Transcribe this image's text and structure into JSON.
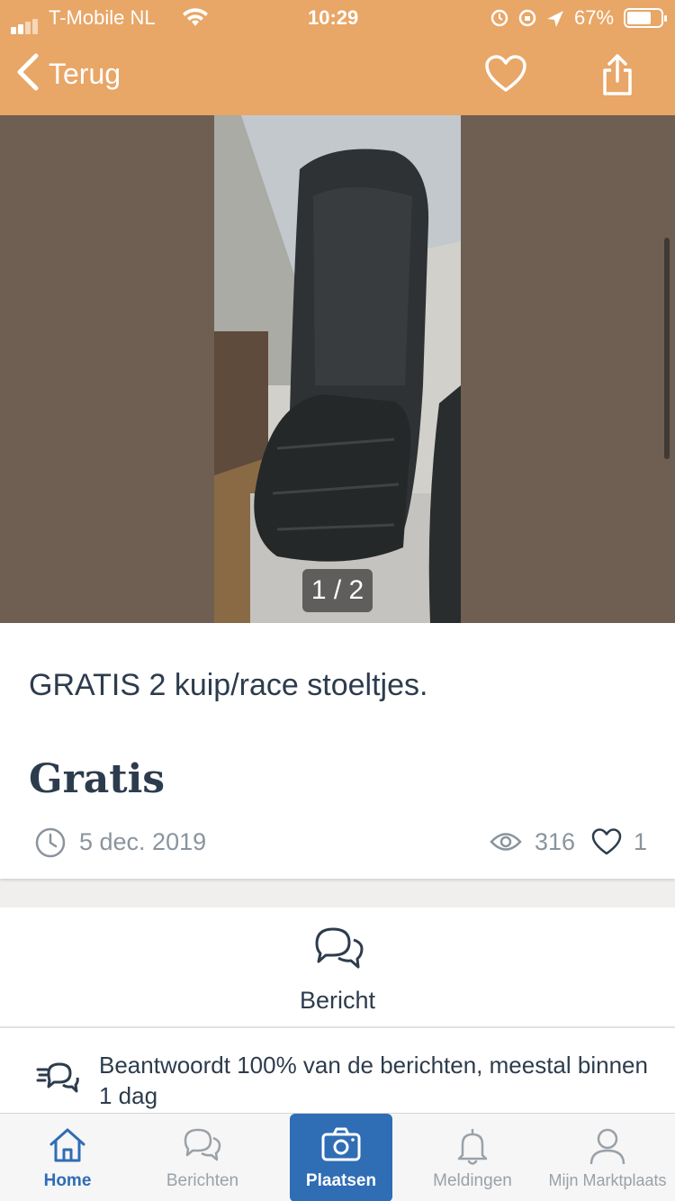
{
  "status_bar": {
    "carrier": "T-Mobile NL",
    "time": "10:29",
    "battery": "67%"
  },
  "nav": {
    "back_label": "Terug"
  },
  "gallery": {
    "counter": "1 / 2"
  },
  "listing": {
    "title": "GRATIS 2 kuip/race stoeltjes.",
    "price": "Gratis",
    "date": "5 dec. 2019",
    "views": "316",
    "favorites": "1"
  },
  "message": {
    "button_label": "Bericht",
    "response_info": "Beantwoordt 100% van de berichten, meestal binnen 1 dag"
  },
  "tabs": [
    {
      "label": "Home",
      "icon": "home-icon"
    },
    {
      "label": "Berichten",
      "icon": "chat-icon"
    },
    {
      "label": "Plaatsen",
      "icon": "camera-icon"
    },
    {
      "label": "Meldingen",
      "icon": "bell-icon"
    },
    {
      "label": "Mijn Marktplaats",
      "icon": "user-icon"
    }
  ],
  "colors": {
    "header": "#e8a667",
    "accent_blue": "#2f6db5",
    "photo_background": "#6f5f53",
    "text_dark": "#2d3c4d"
  }
}
